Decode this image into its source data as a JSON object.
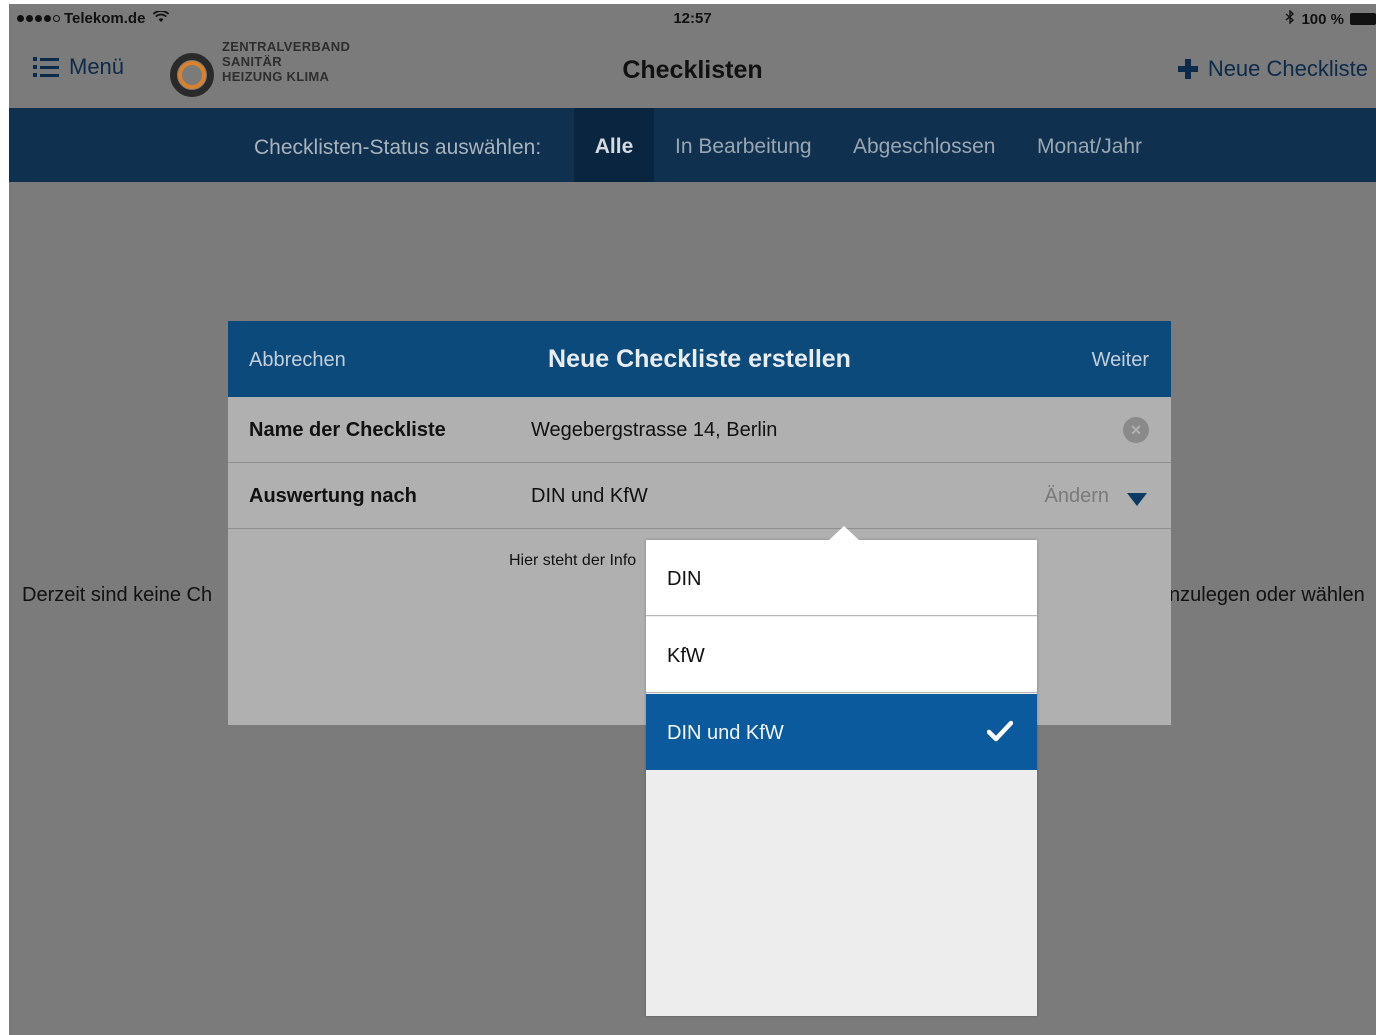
{
  "status_bar": {
    "carrier": "Telekom.de",
    "time": "12:57",
    "battery": "100 %",
    "icons": [
      "signal-dots-icon",
      "wifi-icon",
      "bluetooth-icon",
      "battery-icon"
    ]
  },
  "nav": {
    "menu_label": "Menü",
    "logo_lines": [
      "ZENTRALVERBAND",
      "SANITÄR",
      "HEIZUNG KLIMA"
    ],
    "title": "Checklisten",
    "new_label": "Neue Checkliste"
  },
  "filter": {
    "label": "Checklisten-Status auswählen:",
    "tabs": [
      "Alle",
      "In Bearbeitung",
      "Abgeschlossen",
      "Monat/Jahr"
    ],
    "active_tab": "Alle"
  },
  "background": {
    "empty_left": "Derzeit sind keine Ch",
    "empty_right": "nzulegen oder wählen"
  },
  "modal": {
    "cancel": "Abbrechen",
    "title": "Neue Checkliste erstellen",
    "next": "Weiter",
    "name_label": "Name der Checkliste",
    "name_value": "Wegebergstrasse 14, Berlin",
    "eval_label": "Auswertung nach",
    "eval_value": "DIN und KfW",
    "change_label": "Ändern",
    "info_text": "Hier steht der Info"
  },
  "dropdown": {
    "options": [
      "DIN",
      "KfW",
      "DIN und KfW"
    ],
    "selected": "DIN und KfW"
  },
  "colors": {
    "filter_bar": "#0f304e",
    "modal_header": "#0c4a7c",
    "selected_option": "#0c5a9e",
    "overlay": "#7b7b7b"
  }
}
